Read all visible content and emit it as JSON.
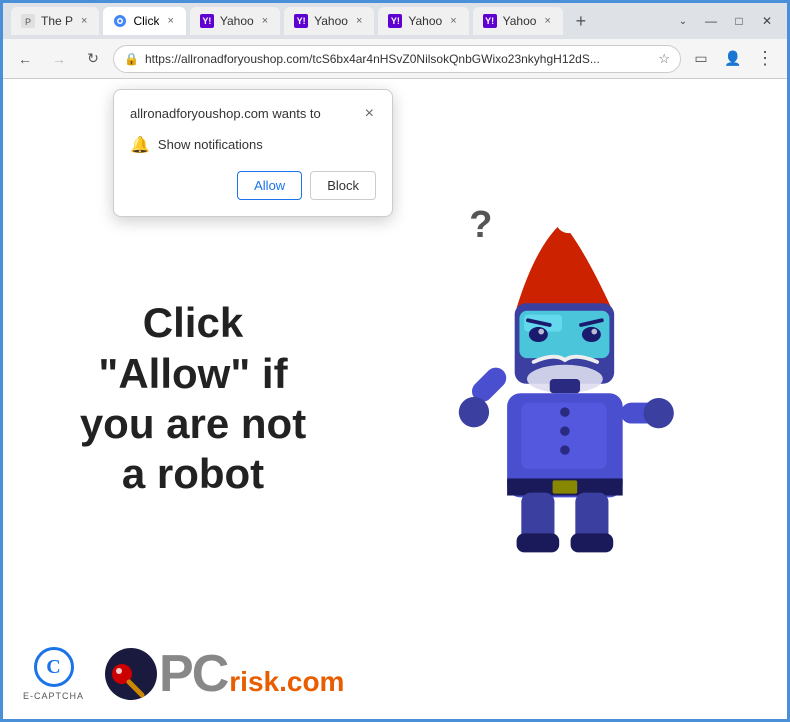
{
  "browser": {
    "tabs": [
      {
        "id": "tab1",
        "label": "The P",
        "favicon": "page",
        "active": false
      },
      {
        "id": "tab2",
        "label": "Click",
        "favicon": "page",
        "active": true
      },
      {
        "id": "tab3",
        "label": "Yahoo",
        "favicon": "yahoo",
        "active": false
      },
      {
        "id": "tab4",
        "label": "Yahoo",
        "favicon": "yahoo",
        "active": false
      },
      {
        "id": "tab5",
        "label": "Yahoo",
        "favicon": "yahoo",
        "active": false
      },
      {
        "id": "tab6",
        "label": "Yahoo",
        "favicon": "yahoo",
        "active": false
      }
    ],
    "address": "https://allronadforyoushop.com/tcS6bx4ar4nHSvZ0NilsokQnbGWixo23nkyhgH12dS...",
    "window_controls": {
      "minimize": "—",
      "maximize": "□",
      "close": "✕"
    }
  },
  "popup": {
    "title": "allronadforyoushop.com wants to",
    "close_label": "×",
    "notification_text": "Show notifications",
    "allow_label": "Allow",
    "block_label": "Block"
  },
  "page": {
    "main_text_line1": "Click",
    "main_text_line2": "\"Allow\"  if",
    "main_text_line3": "you are not",
    "main_text_line4": "a robot"
  },
  "captcha": {
    "logo_letter": "C",
    "label": "E-CAPTCHA"
  },
  "pcrisk": {
    "text": "PC",
    "suffix": "risk.com"
  },
  "icons": {
    "back": "←",
    "forward": "→",
    "refresh": "↻",
    "lock": "🔒",
    "star": "☆",
    "menu": "⋮",
    "sidebar": "▭",
    "profile": "👤",
    "bell": "🔔",
    "question_mark": "?"
  }
}
